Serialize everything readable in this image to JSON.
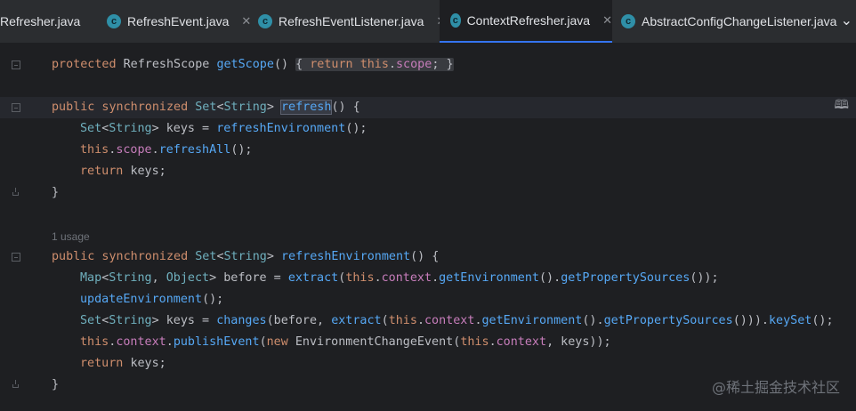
{
  "tabs": [
    {
      "label": "Refresher.java",
      "icon": "class-icon",
      "active": false
    },
    {
      "label": "RefreshEvent.java",
      "icon": "class-icon",
      "active": false
    },
    {
      "label": "RefreshEventListener.java",
      "icon": "class-icon",
      "active": false
    },
    {
      "label": "ContextRefresher.java",
      "icon": "class-icon",
      "active": true
    },
    {
      "label": "AbstractConfigChangeListener.java",
      "icon": "class-icon",
      "active": false
    }
  ],
  "tab_icon_glyph": "c",
  "close_glyph": "✕",
  "more_glyph": "⌄",
  "reader_mode_glyph": "🕮",
  "usage_hint": "1 usage",
  "watermark": "@稀土掘金技术社区",
  "code": {
    "l1": [
      "protected",
      "RefreshScope",
      "getScope",
      "() ",
      "{ ",
      "return ",
      "this",
      ".",
      "scope",
      "; ",
      "}"
    ],
    "l2": [
      "public synchronized ",
      "Set",
      "<",
      "String",
      "> ",
      "refresh",
      "() {"
    ],
    "l3": [
      "Set",
      "<",
      "String",
      "> ",
      "keys = ",
      "refreshEnvironment",
      "();"
    ],
    "l4": [
      "this",
      ".",
      "scope",
      ".",
      "refreshAll",
      "();"
    ],
    "l5": [
      "return ",
      "keys;"
    ],
    "l6": "}",
    "l7": [
      "public synchronized ",
      "Set",
      "<",
      "String",
      "> ",
      "refreshEnvironment",
      "() {"
    ],
    "l8": [
      "Map",
      "<",
      "String",
      ", ",
      "Object",
      "> ",
      "before = ",
      "extract",
      "(",
      "this",
      ".",
      "context",
      ".",
      "getEnvironment",
      "().",
      "getPropertySources",
      "());"
    ],
    "l9": [
      "updateEnvironment",
      "();"
    ],
    "l10": [
      "Set",
      "<",
      "String",
      "> ",
      "keys = ",
      "changes",
      "(before, ",
      "extract",
      "(",
      "this",
      ".",
      "context",
      ".",
      "getEnvironment",
      "().",
      "getPropertySources",
      "())).",
      "keySet",
      "();"
    ],
    "l11": [
      "this",
      ".",
      "context",
      ".",
      "publishEvent",
      "(",
      "new ",
      "EnvironmentChangeEvent",
      "(",
      "this",
      ".",
      "context",
      ", keys));"
    ],
    "l12": [
      "return ",
      "keys;"
    ],
    "l13": "}"
  },
  "colors": {
    "keyword": "#cf8e6d",
    "type": "#6fafbd",
    "method": "#56a8f5",
    "field": "#c77dbb",
    "active_tab_underline": "#3574f0"
  }
}
